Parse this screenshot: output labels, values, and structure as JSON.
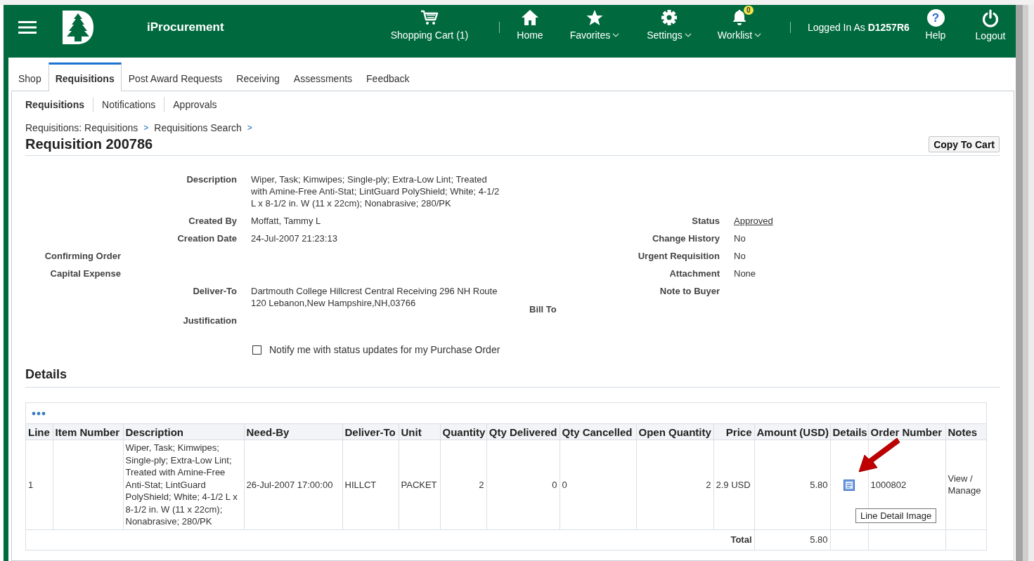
{
  "header": {
    "app_title": "iProcurement",
    "nav": [
      {
        "kind": "cart",
        "label": "Shopping Cart (1)",
        "dropdown": false
      },
      {
        "kind": "home",
        "label": "Home",
        "dropdown": false
      },
      {
        "kind": "star",
        "label": "Favorites",
        "dropdown": true
      },
      {
        "kind": "gear",
        "label": "Settings",
        "dropdown": true
      },
      {
        "kind": "bell",
        "label": "Worklist",
        "dropdown": true,
        "badge": "0"
      }
    ],
    "login": "Logged In As **D1257R6**",
    "actions": [
      {
        "kind": "help",
        "glyph": "?",
        "label": "Help"
      },
      {
        "kind": "power",
        "label": "Logout"
      }
    ]
  },
  "tabs": [
    {
      "label": "Shop",
      "selected": false
    },
    {
      "label": "Requisitions",
      "selected": true
    },
    {
      "label": "Post Award Requests",
      "selected": false
    },
    {
      "label": "Receiving",
      "selected": false
    },
    {
      "label": "Assessments",
      "selected": false
    },
    {
      "label": "Feedback",
      "selected": false
    }
  ],
  "subtabs": [
    {
      "label": "Requisitions",
      "selected": true
    },
    {
      "label": "Notifications",
      "selected": false
    },
    {
      "label": "Approvals",
      "selected": false
    }
  ],
  "breadcrumbs": {
    "items": [
      "Requisitions: Requisitions",
      "Requisitions Search"
    ],
    "separator": ">"
  },
  "title": "Requisition 200786",
  "copy_button": "Copy To Cart",
  "summary": {
    "left_fields": [
      {
        "kind": "main",
        "label": "Description",
        "value": "Wiper, Task; Kimwipes; Single-ply; Extra-Low Lint; Treated with Amine-Free Anti-Stat; LintGuard PolyShield; White; 4-1/2 L x 8-1/2 in. W (11 x 22cm); Nonabrasive; 280/PK"
      },
      {
        "kind": "main",
        "label": "Created By",
        "value": "Moffatt, Tammy L"
      },
      {
        "kind": "main",
        "label": "Creation Date",
        "value": "24-Jul-2007 21:23:13"
      },
      {
        "kind": "side",
        "label": "Confirming Order"
      },
      {
        "kind": "side",
        "label": "Capital Expense"
      },
      {
        "kind": "main",
        "label": "Deliver-To",
        "value": "Dartmouth College Hillcrest Central Receiving 296 NH Route 120 Lebanon,New Hampshire,NH,03766"
      },
      {
        "kind": "main",
        "label": "Justification"
      }
    ],
    "bill_to": "Bill To",
    "right_fields": [
      {
        "label": "Status",
        "value": "Approved",
        "link": true
      },
      {
        "label": "Change History",
        "value": "No",
        "link": false
      },
      {
        "label": "Urgent Requisition",
        "value": "No",
        "link": false
      },
      {
        "label": "Attachment",
        "value": "None",
        "link": false
      },
      {
        "label": "Note to Buyer"
      }
    ],
    "notify": {
      "label": "Notify me with status updates for my Purchase Order",
      "checked": false
    }
  },
  "details": {
    "heading": "Details",
    "columns": [
      {
        "label": "Line",
        "kind": "text"
      },
      {
        "label": "Item Number",
        "kind": "text"
      },
      {
        "label": "Description",
        "kind": "text"
      },
      {
        "label": "Need-By",
        "kind": "text"
      },
      {
        "label": "Deliver-To",
        "kind": "text"
      },
      {
        "label": "Unit",
        "kind": "text"
      },
      {
        "label": "Quantity",
        "kind": "number"
      },
      {
        "label": "Qty Delivered",
        "kind": "number"
      },
      {
        "label": "Qty Cancelled",
        "kind": "text"
      },
      {
        "label": "Open Quantity",
        "kind": "number"
      },
      {
        "label": "Price",
        "kind": "price"
      },
      {
        "label": "Amount (USD)",
        "kind": "number"
      },
      {
        "label": "Details",
        "kind": "text"
      },
      {
        "label": "Order Number",
        "kind": "text"
      },
      {
        "label": "Notes",
        "kind": "text"
      }
    ],
    "rows": [
      {
        "cells": [
          {
            "text": "1"
          },
          {
            "kind": "empty"
          },
          {
            "text": "Wiper, Task; Kimwipes; Single-ply; Extra-Low Lint; Treated with Amine-Free Anti-Stat; LintGuard PolyShield; White; 4-1/2 L x 8-1/2 in. W (11 x 22cm); Nonabrasive; 280/PK"
          },
          {
            "text": "26-Jul-2007 17:00:00"
          },
          {
            "text": "HILLCT"
          },
          {
            "text": "PACKET"
          },
          {
            "text": "2"
          },
          {
            "text": "0"
          },
          {
            "text": "0"
          },
          {
            "text": "2"
          },
          {
            "text": "2.9 USD"
          },
          {
            "text": "5.80"
          },
          {
            "kind": "icon"
          },
          {
            "text": "1000802"
          },
          {
            "text": "View / Manage"
          }
        ]
      }
    ],
    "total": {
      "label": "Total",
      "amount": "5.80"
    },
    "tooltip": "Line Detail Image",
    "annotation": {
      "kind": "arrow"
    }
  }
}
